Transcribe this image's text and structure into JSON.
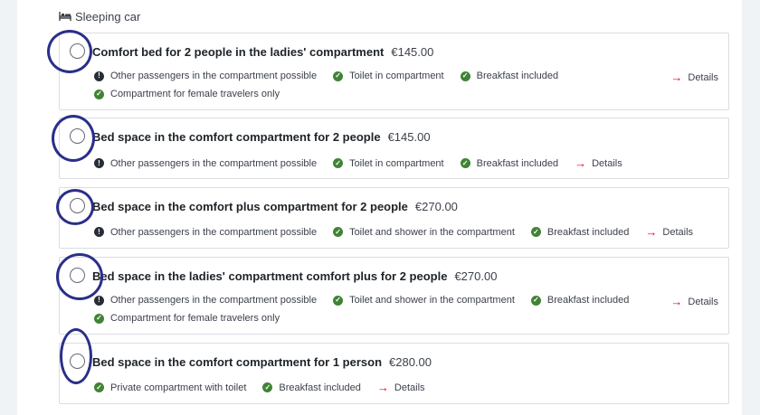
{
  "section": {
    "title": "Sleeping car",
    "icon": "bed-icon"
  },
  "details_label": "Details",
  "options": [
    {
      "title": "Comfort bed for 2 people in the ladies' compartment",
      "price": "€145.00",
      "features": [
        {
          "text": "Other passengers in the compartment possible",
          "icon": "info-icon"
        },
        {
          "text": "Toilet in compartment",
          "icon": "check-icon"
        },
        {
          "text": "Breakfast included",
          "icon": "check-icon"
        }
      ],
      "extra": {
        "text": "Compartment for female travelers only",
        "icon": "check-icon"
      }
    },
    {
      "title": "Bed space in the comfort compartment for 2 people",
      "price": "€145.00",
      "features": [
        {
          "text": "Other passengers in the compartment possible",
          "icon": "info-icon"
        },
        {
          "text": "Toilet in compartment",
          "icon": "check-icon"
        },
        {
          "text": "Breakfast included",
          "icon": "check-icon"
        }
      ]
    },
    {
      "title": "Bed space in the comfort plus compartment for 2 people",
      "price": "€270.00",
      "features": [
        {
          "text": "Other passengers in the compartment possible",
          "icon": "info-icon"
        },
        {
          "text": "Toilet and shower in the compartment",
          "icon": "check-icon"
        },
        {
          "text": "Breakfast included",
          "icon": "check-icon"
        }
      ]
    },
    {
      "title": "Bed space in the ladies' compartment comfort plus for 2 people",
      "price": "€270.00",
      "features": [
        {
          "text": "Other passengers in the compartment possible",
          "icon": "info-icon"
        },
        {
          "text": "Toilet and shower in the compartment",
          "icon": "check-icon"
        },
        {
          "text": "Breakfast included",
          "icon": "check-icon"
        }
      ],
      "extra": {
        "text": "Compartment for female travelers only",
        "icon": "check-icon"
      }
    },
    {
      "title": "Bed space in the comfort compartment for 1 person",
      "price": "€280.00",
      "features": [
        {
          "text": "Private compartment with toilet",
          "icon": "check-icon"
        },
        {
          "text": "Breakfast included",
          "icon": "check-icon"
        }
      ]
    }
  ],
  "colors": {
    "check": "#408335",
    "info": "#282d37",
    "arrow": "#ec0016",
    "annotation": "#2a2f8a"
  }
}
